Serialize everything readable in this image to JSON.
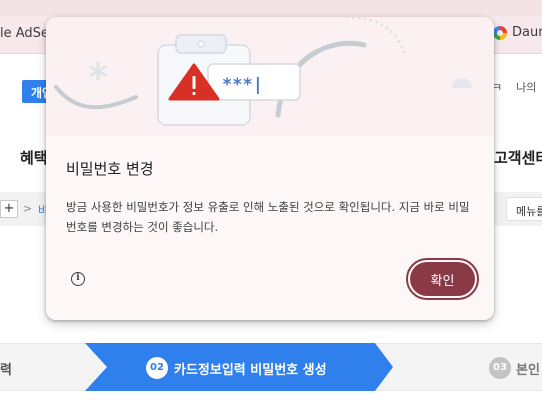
{
  "browser": {
    "bookmark_left": "le AdSen",
    "bookmark_right": "Daum"
  },
  "page": {
    "top_button": "개인",
    "nav_right": [
      "ㅋ",
      "나의"
    ],
    "heading_left": "혜택",
    "heading_right": "고객센터",
    "crumb_plus": "+",
    "crumb_sep": ">",
    "crumb_text": "비",
    "menu_label": "메뉴를",
    "steps": {
      "step1_label": "력",
      "step2_num": "02",
      "step2_label": "카드정보입력 비밀번호 생성",
      "step3_num": "03",
      "step3_label": "본인"
    }
  },
  "dialog": {
    "password_mask": "***|",
    "title": "비밀번호 변경",
    "body": "방금 사용한 비밀번호가 정보 유출로 인해 노출된 것으로 확인됩니다. 지금 바로 비밀번호를 변경하는 것이 좋습니다.",
    "info_symbol": "i",
    "confirm_label": "확인",
    "colors": {
      "accent": "#8a3a46",
      "warning": "#d93025",
      "mask_blue": "#4a78c8"
    }
  }
}
